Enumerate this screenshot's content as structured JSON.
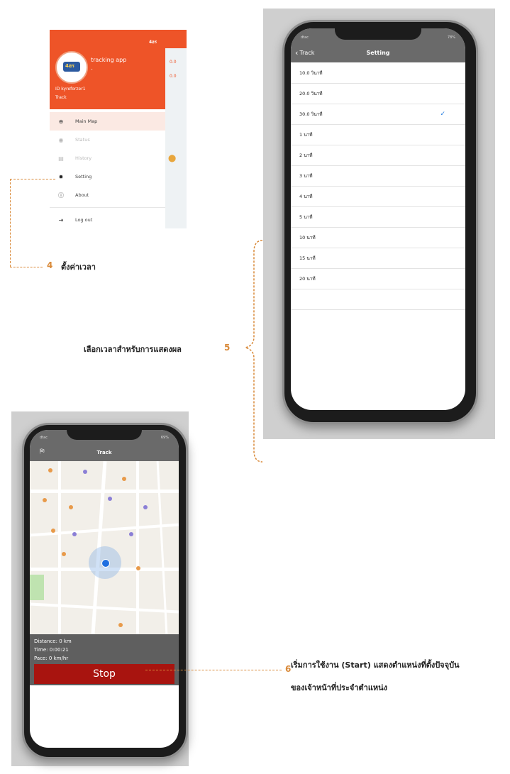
{
  "drawer": {
    "app_name": "tracking app",
    "app_sub": "-",
    "logo_text": "4ฮร",
    "avatar_text": "4ฮร",
    "user_id": "ID kyreforzer1",
    "user_name": "Track",
    "strip_values": [
      "0.0",
      "0.0"
    ],
    "menu": [
      {
        "label": "Main Map",
        "icon": "globe-icon"
      },
      {
        "label": "Status",
        "icon": "eye-icon"
      },
      {
        "label": "History",
        "icon": "list-icon"
      },
      {
        "label": "Setting",
        "icon": "gear-icon"
      },
      {
        "label": "About",
        "icon": "info-icon"
      },
      {
        "label": "Log out",
        "icon": "logout-icon"
      }
    ]
  },
  "callouts": {
    "c4_num": "4",
    "c4_text": "ตั้งค่าเวลา",
    "c5_num": "5",
    "c5_text": "เลือกเวลาสำหรับการแสดงผล",
    "c6_num": "6",
    "c6_line1": "เริ่มการใช้งาน (Start) แสดงตำแหน่งที่ตั้งปัจจุบัน",
    "c6_line2": "ของเจ้าหน้าที่ประจำตำแหน่ง"
  },
  "setting_screen": {
    "back_label": "Track",
    "title": "Setting",
    "status_left": "dtac",
    "status_right": "78%",
    "options": [
      "10.0 วินาที",
      "20.0 วินาที",
      "30.0 วินาที",
      "1 นาที",
      "2 นาที",
      "3 นาที",
      "4 นาที",
      "5 นาที",
      "10 นาที",
      "15 นาที",
      "20 นาที"
    ],
    "selected": "30.0 วินาที"
  },
  "track_screen": {
    "title": "Track",
    "status_left": "dtac",
    "status_right": "69%",
    "distance": "Distance: 0 km",
    "time": "Time: 0:00:21",
    "pace": "Pace: 0 km/hr",
    "stop_label": "Stop"
  },
  "colors": {
    "brand_orange": "#ee5428",
    "callout": "#d98a3a",
    "stop_red": "#a8140f",
    "check_blue": "#1f7ae0"
  }
}
